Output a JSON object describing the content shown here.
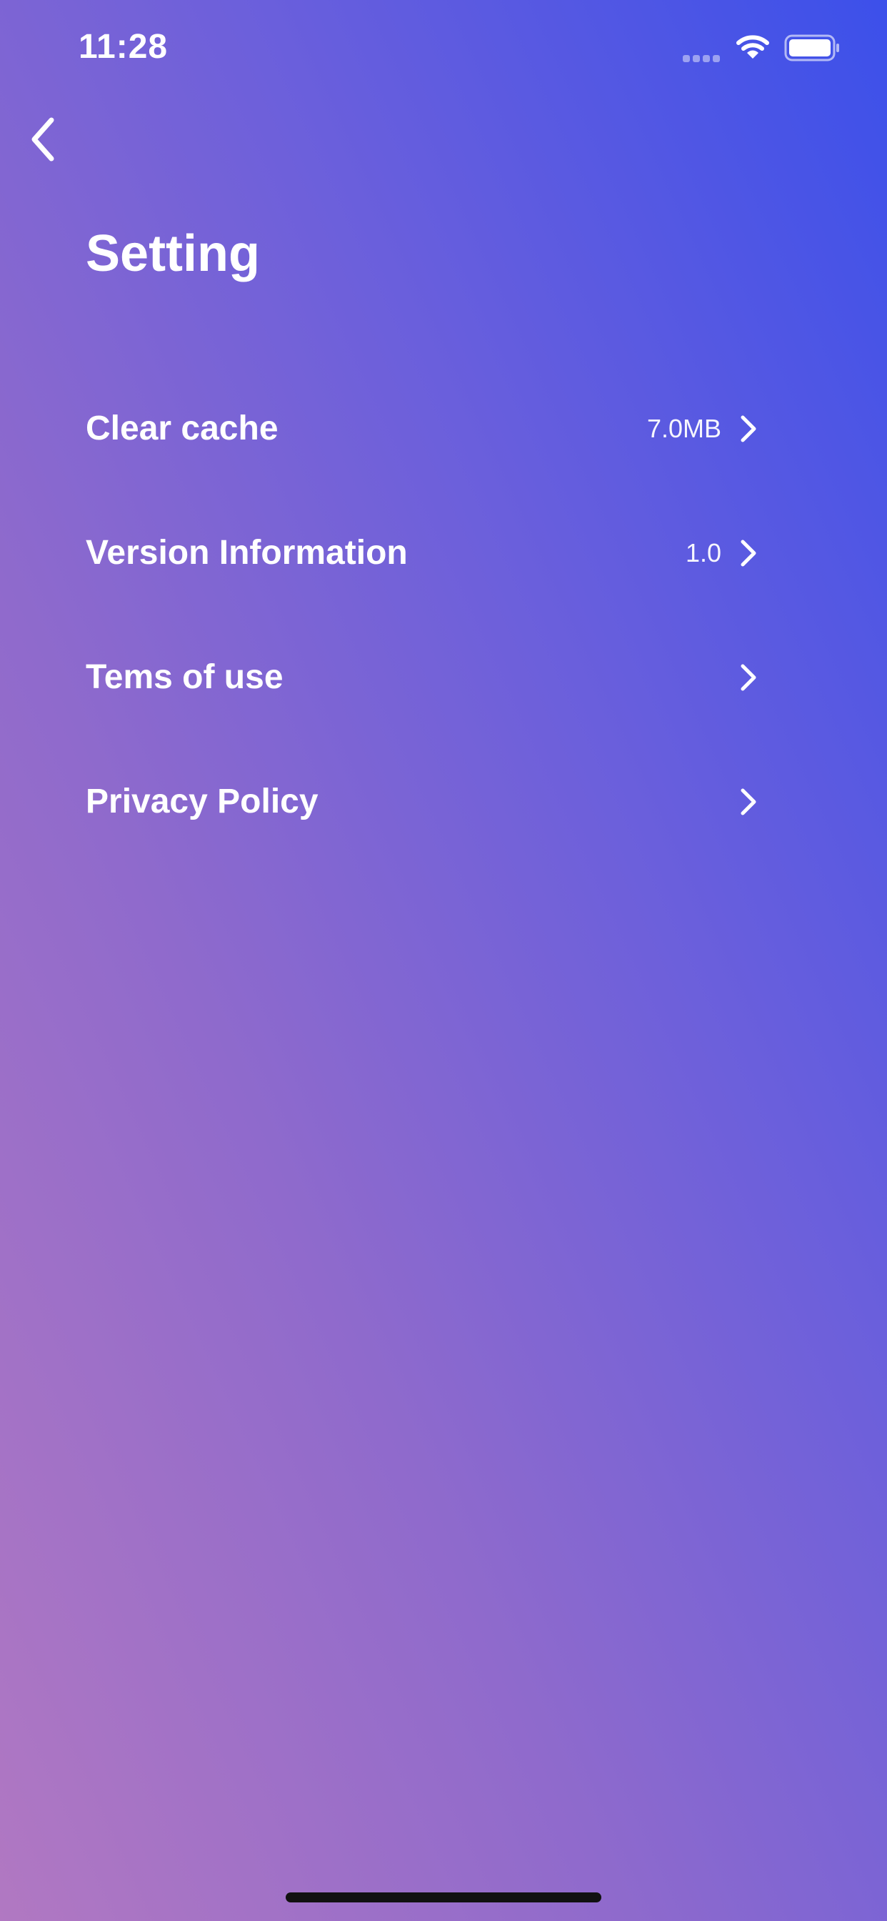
{
  "status_bar": {
    "time": "11:28"
  },
  "header": {
    "title": "Setting"
  },
  "settings": {
    "items": [
      {
        "label": "Clear cache",
        "value": "7.0MB"
      },
      {
        "label": "Version Information",
        "value": "1.0"
      },
      {
        "label": "Tems of use",
        "value": ""
      },
      {
        "label": "Privacy Policy",
        "value": ""
      }
    ]
  },
  "colors": {
    "gradient_top_right": "#3c50ea",
    "gradient_bottom_left": "#b178c2",
    "text": "#ffffff"
  },
  "icons": {
    "back": "chevron-left-icon",
    "row_disclosure": "chevron-right-icon",
    "wifi": "wifi-icon",
    "battery": "battery-icon",
    "signal": "signal-icon"
  }
}
